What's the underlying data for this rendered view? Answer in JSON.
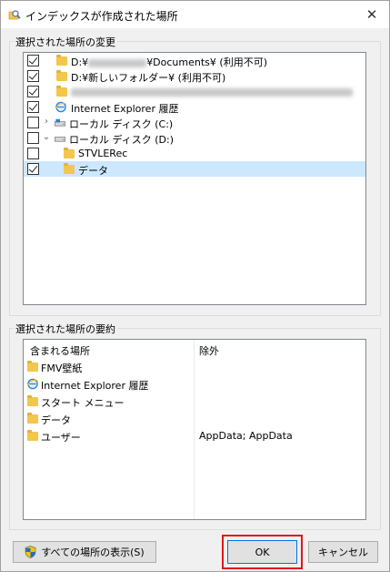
{
  "window": {
    "title": "インデックスが作成された場所",
    "close_label": "✕"
  },
  "selected_locations": {
    "label": "選択された場所の変更",
    "items": [
      {
        "checked": true,
        "text": "D:¥",
        "text_after": "¥Documents¥ (利用不可)",
        "blurred": true
      },
      {
        "checked": true,
        "text": "D:¥新しいフォルダー¥ (利用不可)"
      },
      {
        "checked": true,
        "text": "",
        "blurred_long": true
      },
      {
        "checked": true,
        "text": "Internet Explorer 履歴"
      },
      {
        "checked": false,
        "text": "ローカル ディスク (C:)",
        "expander": "›"
      },
      {
        "checked": false,
        "text": "ローカル ディスク (D:)",
        "expander": "⌄"
      },
      {
        "checked": false,
        "text": "STVLERec"
      },
      {
        "checked": true,
        "text": "データ",
        "selected": true
      }
    ]
  },
  "summary": {
    "label": "選択された場所の要約",
    "col_included": "含まれる場所",
    "col_excluded": "除外",
    "rows": [
      {
        "name": "FMV壁紙",
        "exclude": ""
      },
      {
        "name": "Internet Explorer 履歴",
        "exclude": ""
      },
      {
        "name": "スタート メニュー",
        "exclude": ""
      },
      {
        "name": "データ",
        "exclude": ""
      },
      {
        "name": "ユーザー",
        "exclude": "AppData; AppData"
      }
    ]
  },
  "buttons": {
    "show_all": "すべての場所の表示(S)",
    "ok": "OK",
    "cancel": "キャンセル"
  },
  "colors": {
    "selection": "#cce8ff",
    "highlight_border": "#e0161d",
    "folder": "#f3c64c"
  }
}
